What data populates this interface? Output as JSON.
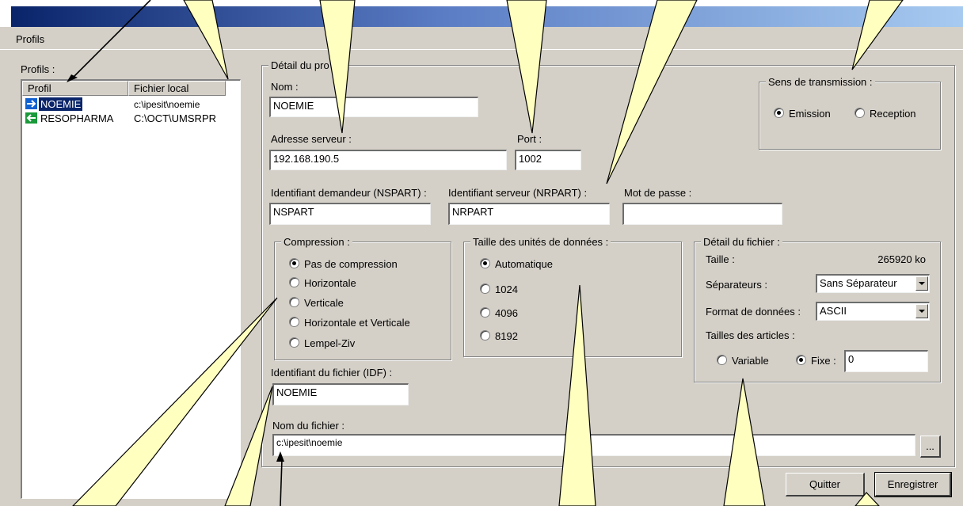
{
  "menu": {
    "profils": "Profils"
  },
  "profiles_group": {
    "label": "Profils :",
    "columns": [
      "Profil",
      "Fichier local"
    ],
    "rows": [
      {
        "name": "NOEMIE",
        "file": "c:\\ipesit\\noemie",
        "direction": "emission",
        "icon": "arrow-right-icon",
        "selected": true
      },
      {
        "name": "RESOPHARMA",
        "file": "C:\\OCT\\UMSRPR",
        "direction": "reception",
        "icon": "arrow-left-icon",
        "selected": false
      }
    ]
  },
  "detail": {
    "label": "Détail du pro",
    "nom_label": "Nom :",
    "nom_value": "NOEMIE",
    "adresse_label": "Adresse serveur :",
    "adresse_value": "192.168.190.5",
    "port_label": "Port :",
    "port_value": "1002",
    "nspart_label": "Identifiant demandeur (NSPART) :",
    "nspart_value": "NSPART",
    "nrpart_label": "Identifiant serveur (NRPART) :",
    "nrpart_value": "NRPART",
    "mdp_label": "Mot de passe :",
    "mdp_value": "",
    "idf_label": "Identifiant du fichier (IDF) :",
    "idf_value": "NOEMIE",
    "nomfichier_label": "Nom du fichier :",
    "nomfichier_value": "c:\\ipesit\\noemie",
    "browse_label": "..."
  },
  "sens": {
    "label": "Sens de transmission :",
    "options": [
      "Emission",
      "Reception"
    ],
    "selected": "Emission"
  },
  "compression": {
    "label": "Compression :",
    "options": [
      "Pas de compression",
      "Horizontale",
      "Verticale",
      "Horizontale et Verticale",
      "Lempel-Ziv"
    ],
    "selected": "Pas de compression"
  },
  "taille_unites": {
    "label": "Taille des unités de données :",
    "options": [
      "Automatique",
      "1024",
      "4096",
      "8192"
    ],
    "selected": "Automatique"
  },
  "fichier": {
    "label": "Détail du fichier :",
    "taille_label": "Taille :",
    "taille_value": "265920 ko",
    "separateurs_label": "Séparateurs :",
    "separateurs_value": "Sans Séparateur",
    "format_label": "Format de données :",
    "format_value": "ASCII",
    "articles_label": "Tailles des articles :",
    "variable_label": "Variable",
    "fixe_label": "Fixe :",
    "fixe_value": "0",
    "selected": "Fixe"
  },
  "buttons": {
    "quitter": "Quitter",
    "enregistrer": "Enregistrer"
  },
  "colors": {
    "callout_fill": "#ffffc0",
    "title_start": "#0a246a",
    "title_end": "#a6caf0",
    "selection": "#0a246a"
  }
}
